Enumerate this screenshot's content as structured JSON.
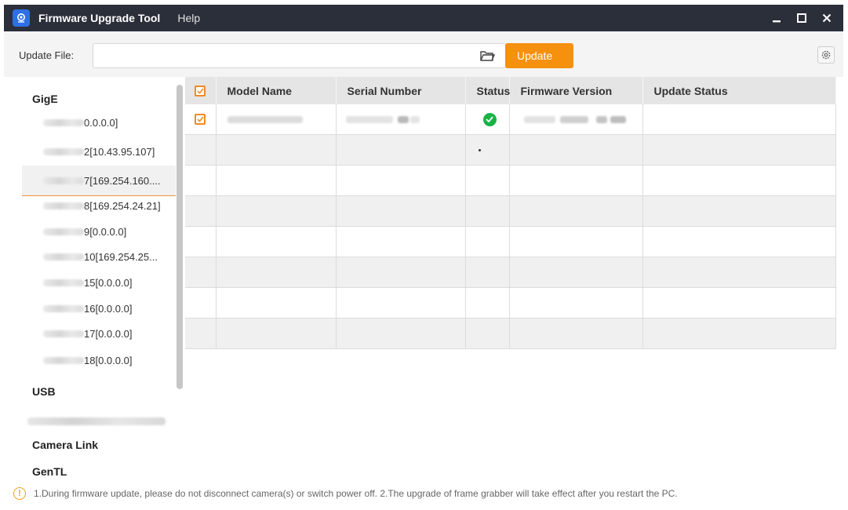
{
  "titlebar": {
    "title": "Firmware Upgrade Tool",
    "menu_help": "Help",
    "icons": [
      "app-icon",
      "minimize-icon",
      "maximize-icon",
      "close-icon"
    ]
  },
  "toolbar": {
    "update_file_label": "Update File:",
    "file_value": "",
    "update_button": "Update",
    "icons": [
      "folder-icon",
      "settings-icon"
    ]
  },
  "left_panel": {
    "groups": {
      "gige": "GigE",
      "usb": "USB",
      "camera_link": "Camera Link",
      "gentl": "GenTL"
    },
    "gige_devices": [
      {
        "suffix": "0.0.0.0]"
      },
      {
        "suffix": "2[10.43.95.107]"
      },
      {
        "suffix": "7[169.254.160....",
        "selected": true
      },
      {
        "suffix": "8[169.254.24.21]"
      },
      {
        "suffix": "9[0.0.0.0]"
      },
      {
        "suffix": "10[169.254.25..."
      },
      {
        "suffix": "15[0.0.0.0]"
      },
      {
        "suffix": "16[0.0.0.0]"
      },
      {
        "suffix": "17[0.0.0.0]"
      },
      {
        "suffix": "18[0.0.0.0]"
      }
    ]
  },
  "table": {
    "headers": {
      "model_name": "Model Name",
      "serial_number": "Serial Number",
      "status": "Status",
      "firmware_version": "Firmware Version",
      "update_status": "Update Status"
    },
    "header_checked": true,
    "rows": [
      {
        "checked": true,
        "status": "ok",
        "update_status": ""
      },
      {
        "checked": false,
        "status": "dot",
        "update_status": ""
      },
      {
        "checked": false,
        "status": "",
        "update_status": ""
      },
      {
        "checked": false,
        "status": "",
        "update_status": ""
      },
      {
        "checked": false,
        "status": "",
        "update_status": ""
      },
      {
        "checked": false,
        "status": "",
        "update_status": ""
      },
      {
        "checked": false,
        "status": "",
        "update_status": ""
      },
      {
        "checked": false,
        "status": "",
        "update_status": ""
      }
    ]
  },
  "footer": {
    "notice": "1.During firmware update, please do not disconnect camera(s) or switch power off. 2.The upgrade of frame grabber will take effect after you restart the PC."
  },
  "colors": {
    "titlebar": "#2b2f3a",
    "accent": "#f5910d",
    "status_ok": "#17b346"
  }
}
